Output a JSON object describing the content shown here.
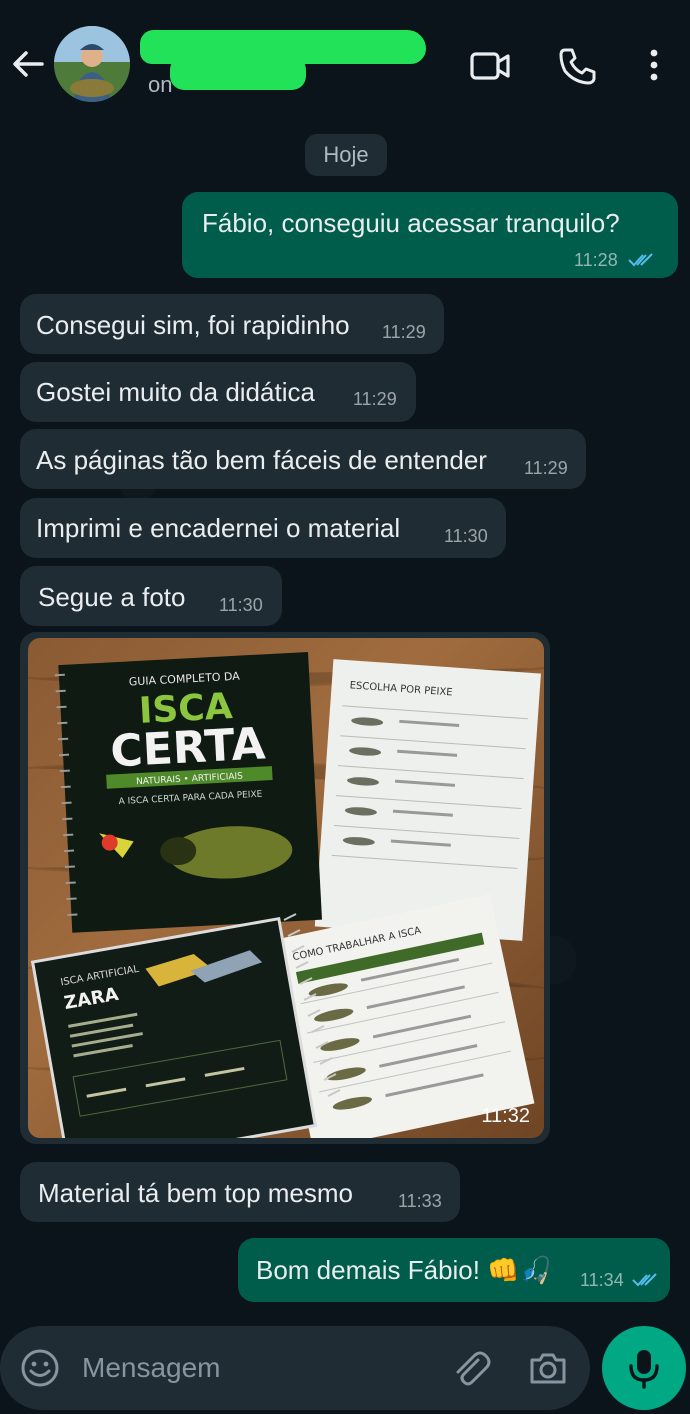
{
  "header": {
    "status": "on",
    "icons": [
      "back-arrow-icon",
      "avatar",
      "video-call-icon",
      "phone-icon",
      "more-vert-icon"
    ]
  },
  "chat": {
    "day_label": "Hoje",
    "messages": [
      {
        "direction": "out",
        "text": "Fábio, conseguiu acessar tranquilo?",
        "time": "11:28",
        "read": true
      },
      {
        "direction": "in",
        "text": "Consegui sim, foi rapidinho",
        "time": "11:29"
      },
      {
        "direction": "in",
        "text": "Gostei muito da didática",
        "time": "11:29"
      },
      {
        "direction": "in",
        "text": "As páginas tão bem fáceis de entender",
        "time": "11:29"
      },
      {
        "direction": "in",
        "text": "Imprimi e encadernei o material",
        "time": "11:30"
      },
      {
        "direction": "in",
        "text": "Segue a foto",
        "time": "11:30"
      },
      {
        "direction": "in",
        "type": "image",
        "time": "11:32"
      },
      {
        "direction": "in",
        "text": "Material tá bem top mesmo",
        "time": "11:33"
      },
      {
        "direction": "out",
        "text": "Bom demais Fábio! 👊🎣",
        "time": "11:34",
        "read": true
      }
    ]
  },
  "photo": {
    "book1": {
      "top_line": "GUIA COMPLETO DA",
      "title1": "ISCA",
      "title2": "CERTA",
      "band": "NATURAIS • ARTIFICIAIS",
      "subtitle": "A ISCA CERTA PARA CADA PEIXE"
    },
    "sheet1_title": "ESCOLHA POR PEIXE",
    "sheet2_title": "COMO TRABALHAR A ISCA",
    "book2_label": "ISCA ARTIFICIAL",
    "book2_title": "ZARA"
  },
  "composer": {
    "placeholder": "Mensagem"
  },
  "colors": {
    "background": "#0b141a",
    "incoming": "#1f2c34",
    "outgoing": "#005c4b",
    "accent": "#00a884",
    "read_ticks": "#53bdeb"
  }
}
